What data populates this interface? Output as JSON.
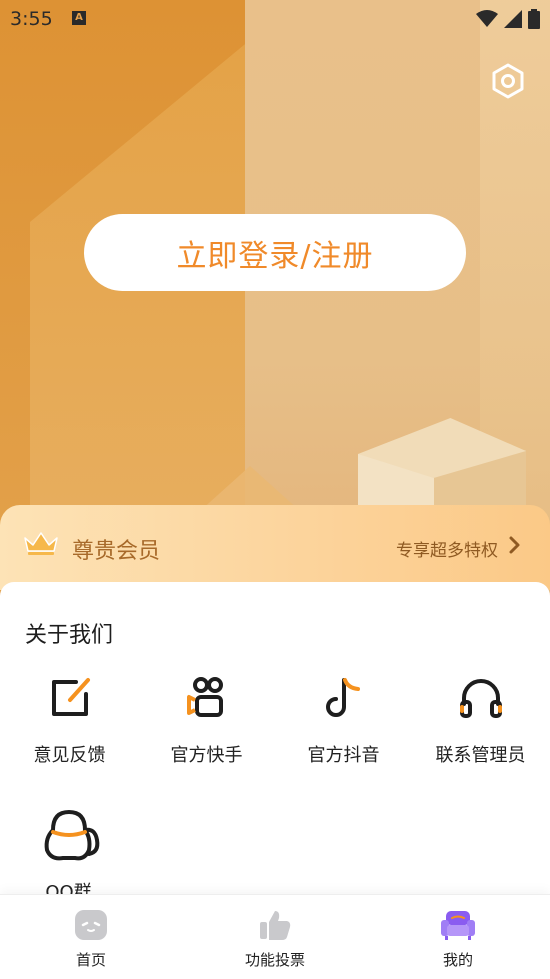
{
  "status_bar": {
    "time": "3:55",
    "notification_letter": "A"
  },
  "header": {
    "login_label": "立即登录/注册"
  },
  "vip": {
    "title": "尊贵会员",
    "privilege_label": "专享超多特权"
  },
  "about": {
    "title": "关于我们",
    "items": [
      {
        "label": "意见反馈",
        "icon": "edit-icon"
      },
      {
        "label": "官方快手",
        "icon": "kuaishou-icon"
      },
      {
        "label": "官方抖音",
        "icon": "douyin-icon"
      },
      {
        "label": "联系管理员",
        "icon": "headset-icon"
      },
      {
        "label": "QQ群",
        "icon": "qq-icon"
      }
    ]
  },
  "nav": {
    "items": [
      {
        "label": "首页",
        "icon": "home-face-icon"
      },
      {
        "label": "功能投票",
        "icon": "thumbs-up-icon"
      },
      {
        "label": "我的",
        "icon": "sofa-icon"
      }
    ]
  },
  "colors": {
    "accent": "#f08a2a",
    "vip_text": "#a86a2a",
    "active_nav": "#8a5cf0"
  }
}
